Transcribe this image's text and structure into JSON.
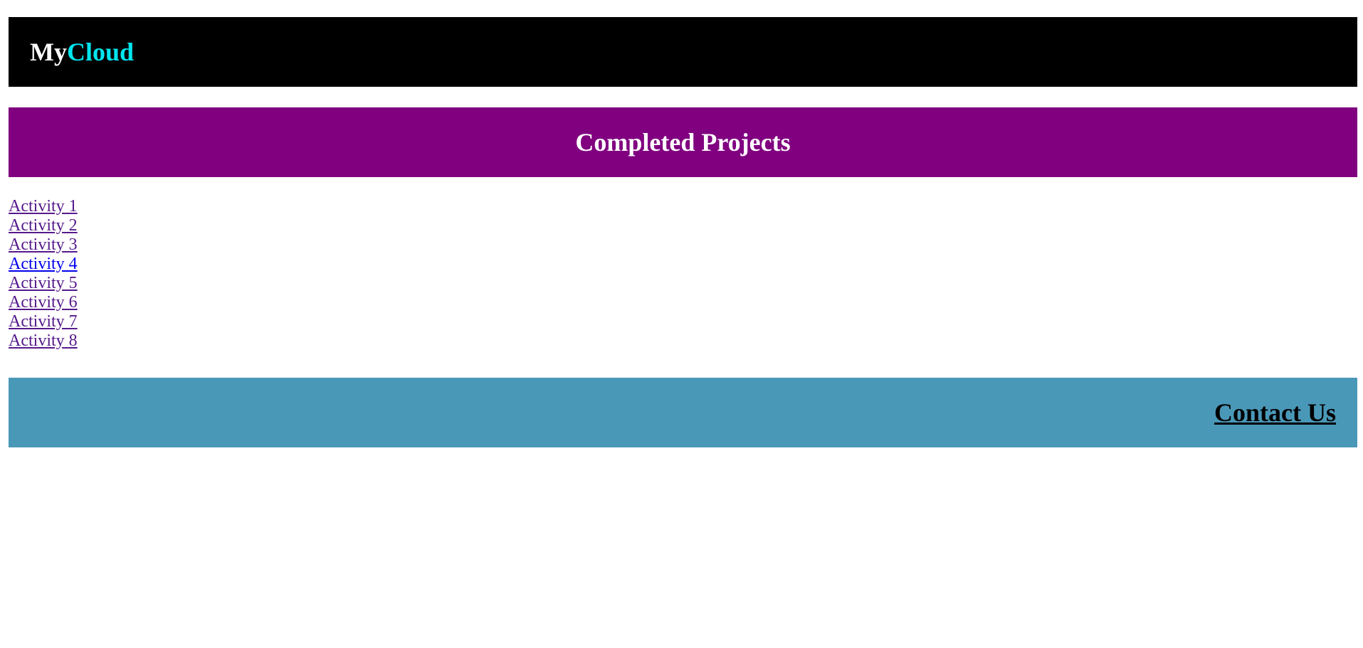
{
  "header": {
    "brand_part1": "My",
    "brand_part2": "Cloud",
    "colors": {
      "background": "#000000",
      "part1": "#ffffff",
      "part2": "#00e5ee"
    }
  },
  "banner": {
    "title": "Completed Projects",
    "background": "#800080"
  },
  "activities": [
    {
      "label": "Activity 1",
      "visited": true
    },
    {
      "label": "Activity 2",
      "visited": true
    },
    {
      "label": "Activity 3",
      "visited": true
    },
    {
      "label": "Activity 4",
      "visited": false
    },
    {
      "label": "Activity 5",
      "visited": true
    },
    {
      "label": "Activity 6",
      "visited": true
    },
    {
      "label": "Activity 7",
      "visited": true
    },
    {
      "label": "Activity 8",
      "visited": true
    }
  ],
  "footer": {
    "contact_label": "Contact Us",
    "background": "#4a98b8"
  }
}
